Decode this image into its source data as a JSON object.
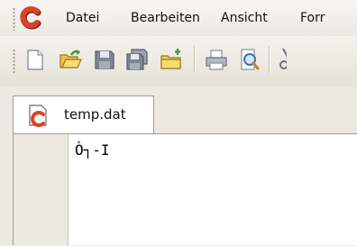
{
  "app": {
    "icon": "app-c-icon"
  },
  "menu": {
    "items": [
      {
        "label": "Datei"
      },
      {
        "label": "Bearbeiten"
      },
      {
        "label": "Ansicht"
      },
      {
        "label": "Forr"
      }
    ]
  },
  "toolbar": {
    "buttons": [
      {
        "icon": "new-file-icon"
      },
      {
        "icon": "open-folder-icon"
      },
      {
        "icon": "save-icon"
      },
      {
        "icon": "save-all-icon"
      },
      {
        "icon": "new-folder-icon"
      },
      {
        "icon": "print-icon"
      },
      {
        "icon": "print-preview-icon"
      },
      {
        "icon": "cut-icon"
      }
    ]
  },
  "tabs": [
    {
      "label": "temp.dat",
      "icon": "file-icon",
      "active": true
    }
  ],
  "editor": {
    "lines": [
      "Ò┐-I"
    ]
  },
  "colors": {
    "app_icon_red": "#d8442a",
    "chrome": "#ebe9e1",
    "editor_bg": "#ffffff"
  }
}
